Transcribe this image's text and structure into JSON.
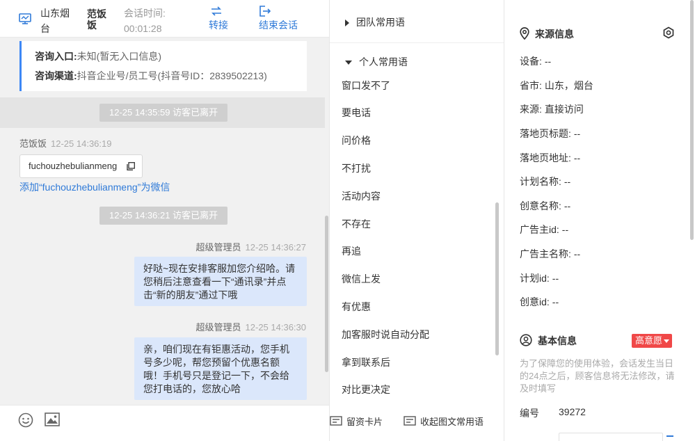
{
  "header": {
    "visitor_name": "山东烟台",
    "agent_name": "范饭饭",
    "session_label": "会话时间:",
    "session_time": "00:01:28",
    "transfer_label": "转接",
    "end_label": "结束会话"
  },
  "source_card": {
    "entry_key": "咨询入口:",
    "entry_value": "未知(暂无入口信息)",
    "channel_key": "咨询渠道:",
    "channel_value": "抖音企业号/员工号(抖音号ID：2839502213)"
  },
  "messages": {
    "system_1": "12-25 14:35:59 访客已离开",
    "visitor_name": "范饭饭",
    "visitor_time": "12-25 14:36:19",
    "wechat_id": "fuchouzhebulianmeng",
    "add_wechat_link": "添加“fuchouzhebulianmeng”为微信",
    "system_2": "12-25 14:36:21 访客已离开",
    "agent_name": "超级管理员",
    "agent_time_1": "12-25 14:36:27",
    "bubble_1": "好哒~现在安排客服加您介绍哈。请您稍后注意查看一下“通讯录”并点击“新的朋友”通过下哦",
    "agent_time_2": "12-25 14:36:30",
    "bubble_2": "亲，咱们现在有钜惠活动，您手机号多少呢，帮您预留个优惠名额哦！手机号只是登记一下，不会给您打电话的，您放心哈"
  },
  "phrases": {
    "team_group": "团队常用语",
    "personal_group": "个人常用语",
    "items": [
      "窗口发不了",
      "要电话",
      "问价格",
      "不打扰",
      "活动内容",
      "不存在",
      "再追",
      "微信上发",
      "有优惠",
      "加客服时说自动分配",
      "拿到联系后",
      "对比更决定"
    ],
    "footer_card": "留资卡片",
    "footer_collect": "收起图文常用语"
  },
  "source_info": {
    "title": "来源信息",
    "rows": [
      {
        "key": "设备:",
        "value": "--"
      },
      {
        "key": "省市:",
        "value": "山东，烟台"
      },
      {
        "key": "来源:",
        "value": "直接访问"
      },
      {
        "key": "落地页标题:",
        "value": "--"
      },
      {
        "key": "落地页地址:",
        "value": "--"
      },
      {
        "key": "计划名称:",
        "value": "--"
      },
      {
        "key": "创意名称:",
        "value": "--"
      },
      {
        "key": "广告主id:",
        "value": "--"
      },
      {
        "key": "广告主名称:",
        "value": "--"
      },
      {
        "key": "计划id:",
        "value": "--"
      },
      {
        "key": "创意id:",
        "value": "--"
      }
    ]
  },
  "basic_info": {
    "title": "基本信息",
    "intent_badge": "高意愿",
    "note": "为了保障您的使用体验，会话发生当日的24点之后，顾客信息将无法修改，请及时填写",
    "id_label": "编号",
    "id_value": "39272"
  },
  "colors": {
    "accent": "#2f7ad8",
    "bubble": "#dbe7fb",
    "badge": "#f04848",
    "card_border": "#3d87f5"
  },
  "icons": [
    "monitor-icon",
    "transfer-icon",
    "exit-icon",
    "copy-icon",
    "emoji-icon",
    "image-icon",
    "location-icon",
    "settings-icon",
    "user-circle-icon",
    "card-icon",
    "collapse-icon"
  ]
}
